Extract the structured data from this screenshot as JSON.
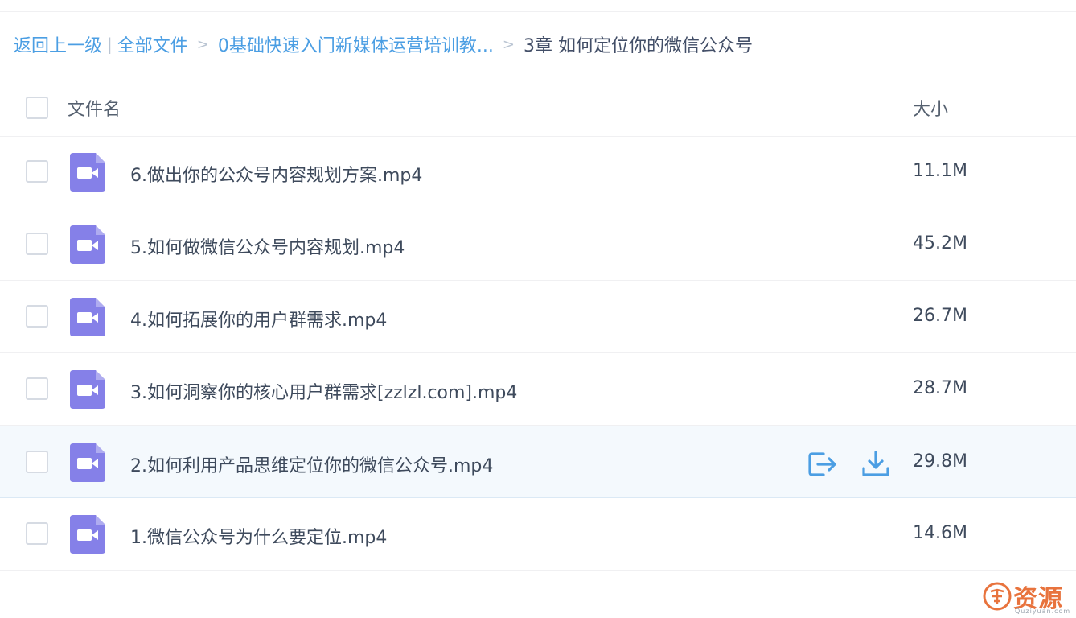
{
  "breadcrumb": {
    "back": "返回上一级",
    "pipe": "|",
    "all_files": "全部文件",
    "separator": ">",
    "folder": "0基础快速入门新媒体运营培训教...",
    "current": "3章 如何定位你的微信公众号"
  },
  "table": {
    "header_name": "文件名",
    "header_size": "大小",
    "rows": [
      {
        "name": "6.做出你的公众号内容规划方案.mp4",
        "size": "11.1M",
        "icon": "video-file-icon"
      },
      {
        "name": "5.如何做微信公众号内容规划.mp4",
        "size": "45.2M",
        "icon": "video-file-icon"
      },
      {
        "name": "4.如何拓展你的用户群需求.mp4",
        "size": "26.7M",
        "icon": "video-file-icon"
      },
      {
        "name": "3.如何洞察你的核心用户群需求[zzlzl.com].mp4",
        "size": "28.7M",
        "icon": "video-file-icon"
      },
      {
        "name": "2.如何利用产品思维定位你的微信公众号.mp4",
        "size": "29.8M",
        "icon": "video-file-icon",
        "hovered": true,
        "actions": [
          "share-icon",
          "download-icon"
        ]
      },
      {
        "name": "1.微信公众号为什么要定位.mp4",
        "size": "14.6M",
        "icon": "video-file-icon"
      }
    ]
  },
  "watermark": {
    "text": "资源",
    "sub": "Quziyuan.com"
  },
  "colors": {
    "link": "#4b9ee3",
    "video_icon": "#8580e8",
    "hover_row": "#f4f9fd",
    "watermark": "#e8733d"
  }
}
